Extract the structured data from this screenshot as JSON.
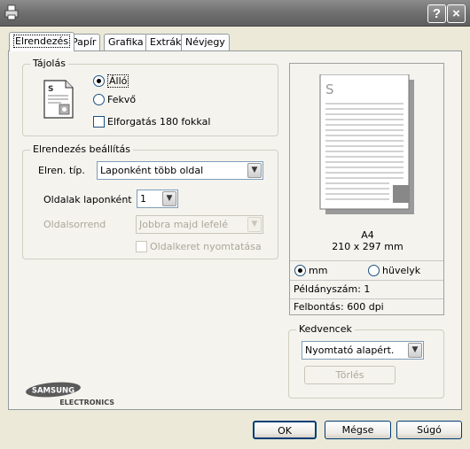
{
  "tabs": [
    {
      "label": "Elrendezés"
    },
    {
      "label": "Papír"
    },
    {
      "label": "Grafika"
    },
    {
      "label": "Extrák"
    },
    {
      "label": "Névjegy"
    }
  ],
  "titlebar": {
    "help": "?",
    "close": "×"
  },
  "orientation": {
    "legend": "Tájolás",
    "portrait": "Álló",
    "landscape": "Fekvő",
    "rotate": "Elforgatás 180 fokkal",
    "selected": "portrait"
  },
  "layout": {
    "legend": "Elrendezés beállítás",
    "type_label": "Elren. típ.",
    "type_value": "Laponként több oldal",
    "pages_label": "Oldalak laponként",
    "pages_value": "1",
    "order_label": "Oldalsorrend",
    "order_value": "Jobbra majd lefelé",
    "border_label": "Oldalkeret nyomtatása"
  },
  "preview": {
    "paper": "A4",
    "size": "210 x 297 mm",
    "unit_mm": "mm",
    "unit_inch": "hüvelyk",
    "copies": "Példányszám: 1",
    "resolution": "Felbontás: 600 dpi"
  },
  "favorites": {
    "legend": "Kedvencek",
    "value": "Nyomtató alapért.",
    "delete": "Törlés"
  },
  "logo": {
    "brand": "SAMSUNG",
    "sub": "ELECTRONICS"
  },
  "buttons": {
    "ok": "OK",
    "cancel": "Mégse",
    "help": "Súgó"
  },
  "colors": {
    "accent": "#003c74",
    "panel": "#f4f3ee"
  }
}
